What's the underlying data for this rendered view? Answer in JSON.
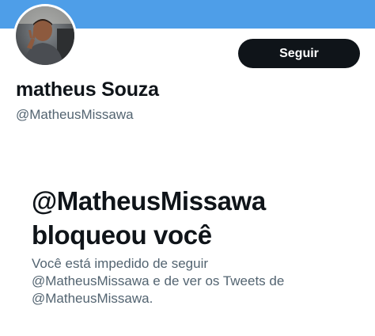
{
  "header": {
    "banner_color": "#4e9ee8",
    "follow_label": "Seguir"
  },
  "profile": {
    "avatar_icon": "profile-photo",
    "display_name": "matheus Souza",
    "handle": "@MatheusMissawa"
  },
  "blocked_notice": {
    "title_line1": "@MatheusMissawa",
    "title_line2": "bloqueou você",
    "desc_line1": "Você está impedido de seguir",
    "desc_line2": "@MatheusMissawa e de ver os Tweets de",
    "desc_line3": "@MatheusMissawa."
  },
  "colors": {
    "text_primary": "#0f1419",
    "text_secondary": "#536471",
    "button_bg": "#0f1419"
  }
}
